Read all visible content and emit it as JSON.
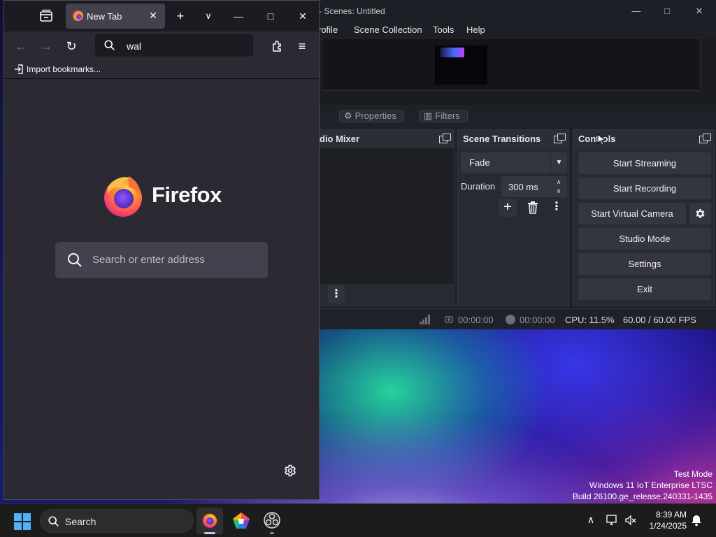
{
  "desktop": {
    "watermark": [
      "Test Mode",
      "Windows 11 IoT Enterprise LTSC",
      "Build 26100.ge_release.240331-1435"
    ]
  },
  "obs": {
    "title": "- Scenes: Untitled",
    "menu": [
      "rofile",
      "Scene Collection",
      "Tools",
      "Help"
    ],
    "source_buttons": {
      "properties": "Properties",
      "filters": "Filters"
    },
    "mixer": {
      "title": "dio Mixer"
    },
    "transitions": {
      "title": "Scene Transitions",
      "selected": "Fade",
      "duration_label": "Duration",
      "duration_value": "300 ms"
    },
    "controls": {
      "title": "Controls",
      "start_streaming": "Start Streaming",
      "start_recording": "Start Recording",
      "start_virtual_camera": "Start Virtual Camera",
      "studio_mode": "Studio Mode",
      "settings": "Settings",
      "exit": "Exit"
    },
    "status": {
      "stream_time": "00:00:00",
      "record_time": "00:00:00",
      "cpu": "CPU: 11.5%",
      "fps": "60.00 / 60.00 FPS"
    }
  },
  "firefox": {
    "tab_title": "New Tab",
    "url_text": "wal",
    "bookmarks": {
      "import": "Import bookmarks..."
    },
    "wordmark": "Firefox",
    "search_placeholder": "Search or enter address"
  },
  "taskbar": {
    "search_label": "Search",
    "time": "8:39 AM",
    "date": "1/24/2025",
    "apps": [
      "firefox-icon",
      "app-pentagon-icon",
      "obs-studio-icon"
    ]
  },
  "colors": {
    "firefox_bg": "#2b2a33",
    "obs_bg": "#1f2128",
    "obs_button": "#33363f",
    "taskbar_bg": "#1c1c1c",
    "windows_accent": "#4fb2ff"
  }
}
